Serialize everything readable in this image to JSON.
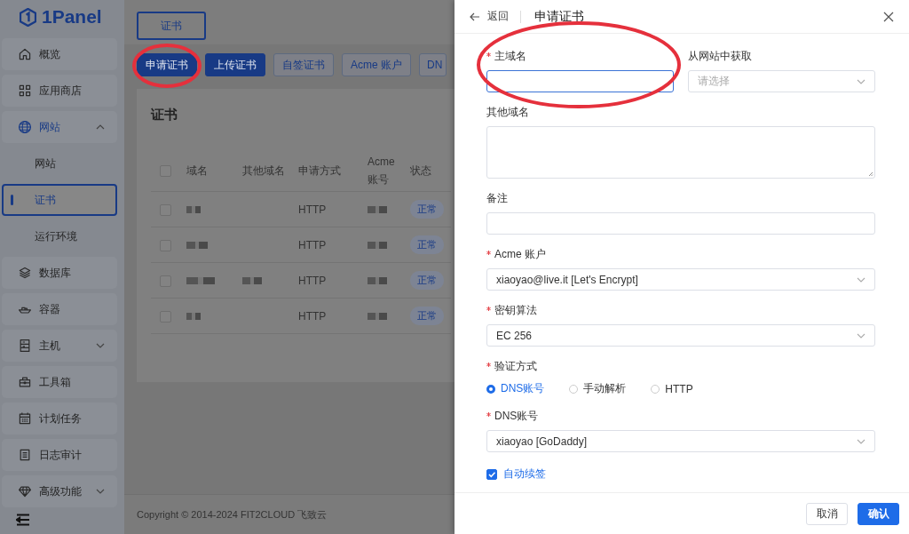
{
  "app": {
    "logo_text": "1Panel"
  },
  "sidebar": {
    "items": [
      {
        "label": "概览",
        "selected": false
      },
      {
        "label": "应用商店",
        "selected": false
      },
      {
        "label": "网站",
        "selected": false,
        "expanded": true,
        "children": [
          {
            "label": "网站",
            "selected": false
          },
          {
            "label": "证书",
            "selected": true
          },
          {
            "label": "运行环境",
            "selected": false
          }
        ]
      },
      {
        "label": "数据库",
        "selected": false
      },
      {
        "label": "容器",
        "selected": false
      },
      {
        "label": "主机",
        "selected": false,
        "expanded": false
      },
      {
        "label": "工具箱",
        "selected": false
      },
      {
        "label": "计划任务",
        "selected": false
      },
      {
        "label": "日志审计",
        "selected": false
      },
      {
        "label": "高级功能",
        "selected": false,
        "expanded": false
      }
    ]
  },
  "main": {
    "tab": {
      "label": "证书",
      "selected": true
    },
    "actions": [
      {
        "label": "申请证书",
        "kind": "primary"
      },
      {
        "label": "上传证书",
        "kind": "primary"
      },
      {
        "label": "自签证书",
        "kind": "secondary"
      },
      {
        "label": "Acme 账户",
        "kind": "secondary"
      },
      {
        "label": "DN",
        "kind": "secondary"
      }
    ],
    "card": {
      "title": "证书",
      "table": {
        "all_checked": false,
        "columns": [
          "域名",
          "其他域名",
          "申请方式",
          "Acme 账号",
          "状态"
        ],
        "rows": [
          {
            "checked": false,
            "other_domain_shown": false,
            "method": "HTTP",
            "status": "正常"
          },
          {
            "checked": false,
            "other_domain_shown": false,
            "method": "HTTP",
            "status": "正常"
          },
          {
            "checked": false,
            "other_domain_shown": true,
            "method": "HTTP",
            "status": "正常"
          },
          {
            "checked": false,
            "other_domain_shown": false,
            "method": "HTTP",
            "status": "正常"
          }
        ]
      }
    },
    "footer": "Copyright © 2014-2024 FIT2CLOUD 飞致云"
  },
  "drawer": {
    "back": "返回",
    "title": "申请证书",
    "primary_domain": {
      "label": "主域名",
      "required": true,
      "focused": true
    },
    "from_website": {
      "label": "从网站中获取",
      "required": false,
      "placeholder": "请选择"
    },
    "fields": [
      {
        "kind": "textarea",
        "label": "其他域名",
        "required": false
      },
      {
        "kind": "input",
        "label": "备注",
        "required": false
      },
      {
        "kind": "select",
        "label": "Acme 账户",
        "required": true,
        "value": "xiaoyao@live.it [Let's Encrypt]"
      },
      {
        "kind": "select",
        "label": "密钥算法",
        "required": true,
        "value": "EC 256"
      },
      {
        "kind": "radio",
        "label": "验证方式",
        "required": true,
        "options": [
          {
            "label": "DNS账号",
            "selected": true
          },
          {
            "label": "手动解析",
            "selected": false
          },
          {
            "label": "HTTP",
            "selected": false
          }
        ]
      },
      {
        "kind": "select",
        "label": "DNS账号",
        "required": true,
        "value": "xiaoyao [GoDaddy]"
      },
      {
        "kind": "checkbox",
        "label": "自动续签",
        "checked": true
      }
    ],
    "buttons": [
      {
        "label": "取消",
        "kind": "secondary"
      },
      {
        "label": "确认",
        "kind": "primary"
      }
    ]
  }
}
